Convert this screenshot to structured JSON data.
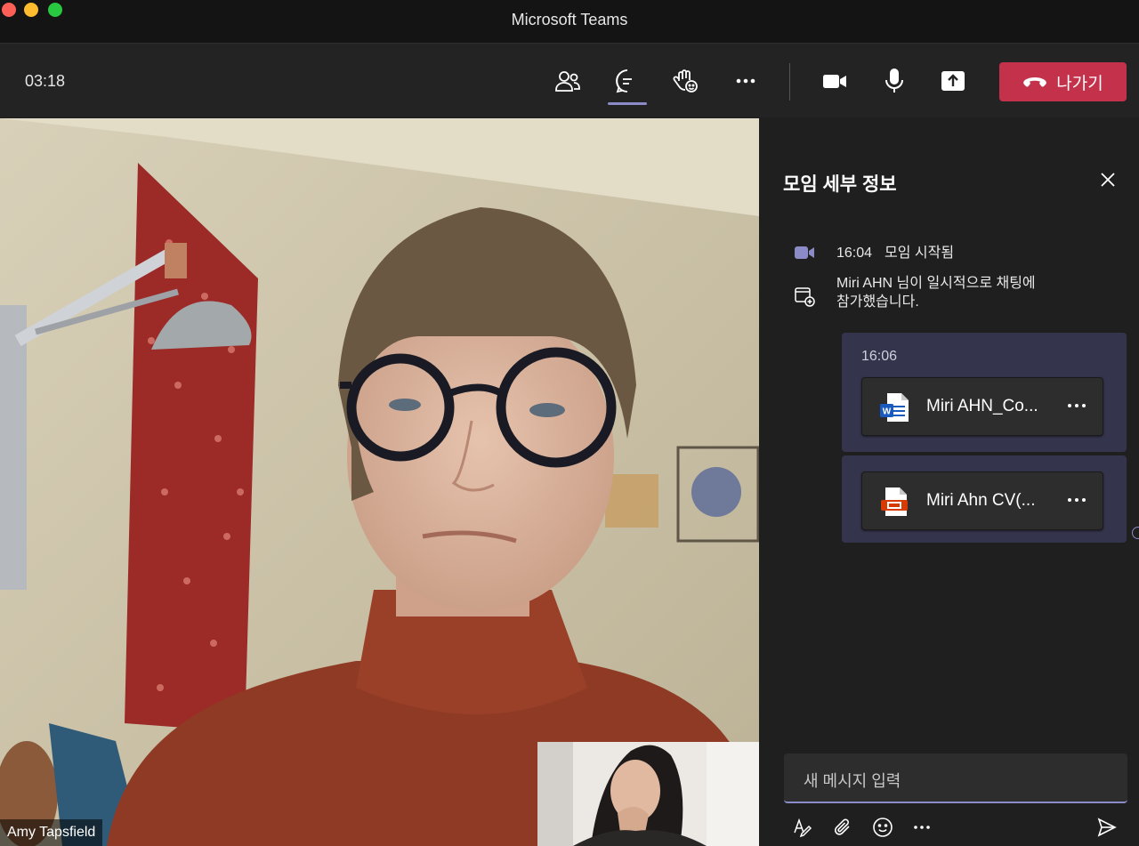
{
  "window": {
    "title": "Microsoft Teams"
  },
  "toolbar": {
    "timer": "03:18",
    "buttons": [
      {
        "name": "participants",
        "icon": "people-icon"
      },
      {
        "name": "chat",
        "icon": "chat-icon",
        "active": true
      },
      {
        "name": "reactions",
        "icon": "raise-hand-icon"
      },
      {
        "name": "more",
        "icon": "more-icon"
      },
      {
        "name": "camera",
        "icon": "camera-icon"
      },
      {
        "name": "microphone",
        "icon": "microphone-icon"
      },
      {
        "name": "share",
        "icon": "share-screen-icon"
      }
    ],
    "leave_label": "나가기",
    "leave_color": "#c4314b"
  },
  "video": {
    "participant_name": "Amy Tapsfield"
  },
  "panel": {
    "title": "모임 세부 정보",
    "events": [
      {
        "time": "16:04",
        "text": "모임 시작됨",
        "icon": "video-meeting-icon"
      },
      {
        "text_line1": "Miri AHN 님이 일시적으로 채팅에",
        "text_line2": "참가했습니다.",
        "icon": "calendar-add-icon"
      }
    ],
    "message": {
      "time": "16:06",
      "files": [
        {
          "name": "Miri AHN_Co...",
          "icon": "word-file-icon"
        },
        {
          "name": "Miri Ahn CV(...",
          "icon": "pdf-file-icon"
        }
      ]
    },
    "compose": {
      "placeholder": "새 메시지 입력"
    },
    "accent": "#8b8cc7",
    "bubble_color": "#34344d"
  }
}
